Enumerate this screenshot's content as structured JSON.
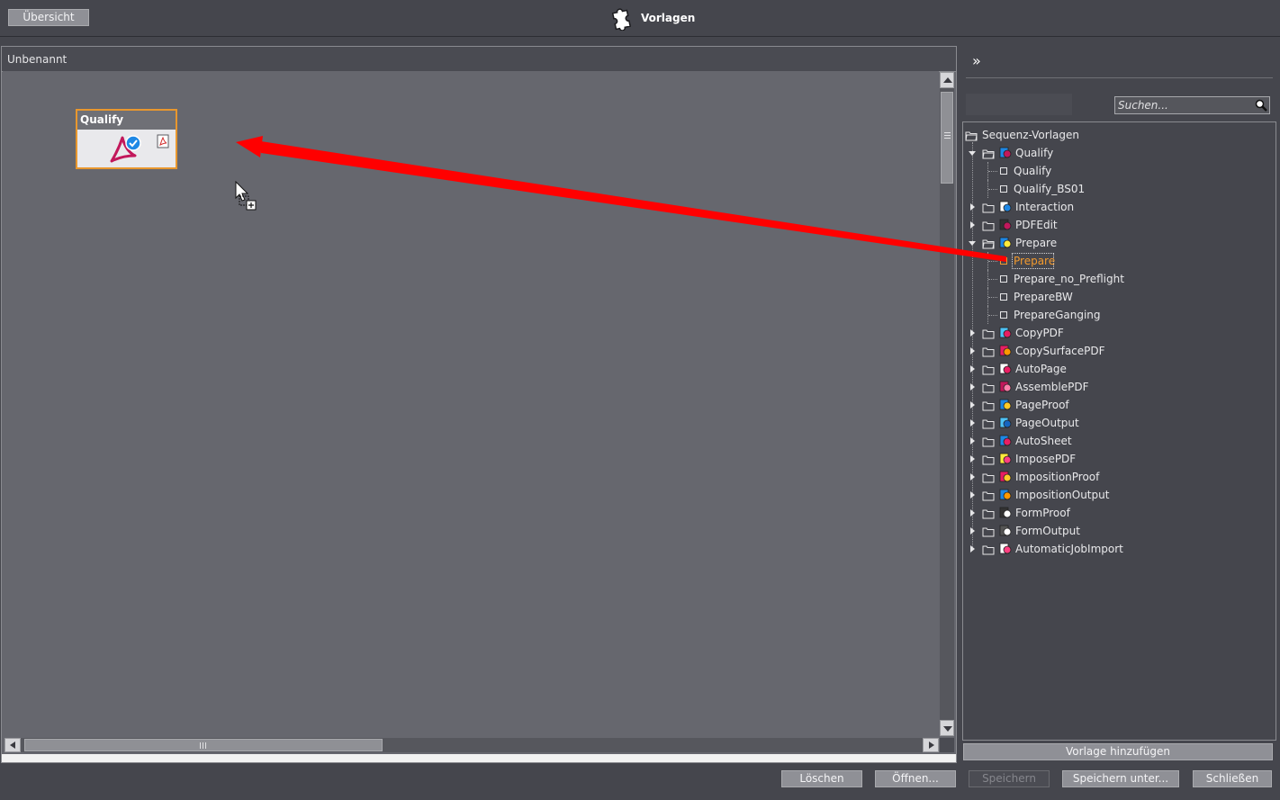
{
  "topbar": {
    "overview_label": "Übersicht",
    "title": "Vorlagen"
  },
  "editor": {
    "tab_title": "Unbenannt",
    "node": {
      "title": "Qualify"
    }
  },
  "right_panel": {
    "collapse_label": "»",
    "search_placeholder": "Suchen...",
    "add_template_label": "Vorlage hinzufügen"
  },
  "tree": {
    "root": "Sequenz-Vorlagen",
    "items": [
      {
        "label": "Qualify",
        "level": 1,
        "expanded": true,
        "icon": "qualify-icon"
      },
      {
        "label": "Qualify",
        "level": 2
      },
      {
        "label": "Qualify_BS01",
        "level": 2
      },
      {
        "label": "Interaction",
        "level": 1,
        "expanded": false,
        "icon": "interaction-icon"
      },
      {
        "label": "PDFEdit",
        "level": 1,
        "expanded": false,
        "icon": "pdfedit-icon"
      },
      {
        "label": "Prepare",
        "level": 1,
        "expanded": true,
        "icon": "prepare-icon"
      },
      {
        "label": "Prepare",
        "level": 2,
        "selected": true
      },
      {
        "label": "Prepare_no_Preflight",
        "level": 2
      },
      {
        "label": "PrepareBW",
        "level": 2
      },
      {
        "label": "PrepareGanging",
        "level": 2
      },
      {
        "label": "CopyPDF",
        "level": 1,
        "expanded": false,
        "icon": "copypdf-icon"
      },
      {
        "label": "CopySurfacePDF",
        "level": 1,
        "expanded": false,
        "icon": "copysurfacepdf-icon"
      },
      {
        "label": "AutoPage",
        "level": 1,
        "expanded": false,
        "icon": "autopage-icon"
      },
      {
        "label": "AssemblePDF",
        "level": 1,
        "expanded": false,
        "icon": "assemblepdf-icon"
      },
      {
        "label": "PageProof",
        "level": 1,
        "expanded": false,
        "icon": "pageproof-icon"
      },
      {
        "label": "PageOutput",
        "level": 1,
        "expanded": false,
        "icon": "pageoutput-icon"
      },
      {
        "label": "AutoSheet",
        "level": 1,
        "expanded": false,
        "icon": "autosheet-icon"
      },
      {
        "label": "ImposePDF",
        "level": 1,
        "expanded": false,
        "icon": "imposepdf-icon"
      },
      {
        "label": "ImpositionProof",
        "level": 1,
        "expanded": false,
        "icon": "impositionproof-icon"
      },
      {
        "label": "ImpositionOutput",
        "level": 1,
        "expanded": false,
        "icon": "impositionoutput-icon"
      },
      {
        "label": "FormProof",
        "level": 1,
        "expanded": false,
        "icon": "formproof-icon"
      },
      {
        "label": "FormOutput",
        "level": 1,
        "expanded": false,
        "icon": "formoutput-icon"
      },
      {
        "label": "AutomaticJobImport",
        "level": 1,
        "expanded": false,
        "icon": "automaticjobimport-icon"
      }
    ]
  },
  "footer": {
    "delete_label": "Löschen",
    "open_label": "Öffnen...",
    "save_label": "Speichern",
    "save_as_label": "Speichern unter...",
    "close_label": "Schließen"
  },
  "colors": {
    "background": "#45464d",
    "canvas": "#66676e",
    "selection": "#e8972e",
    "annotation_arrow": "#ff0000"
  }
}
